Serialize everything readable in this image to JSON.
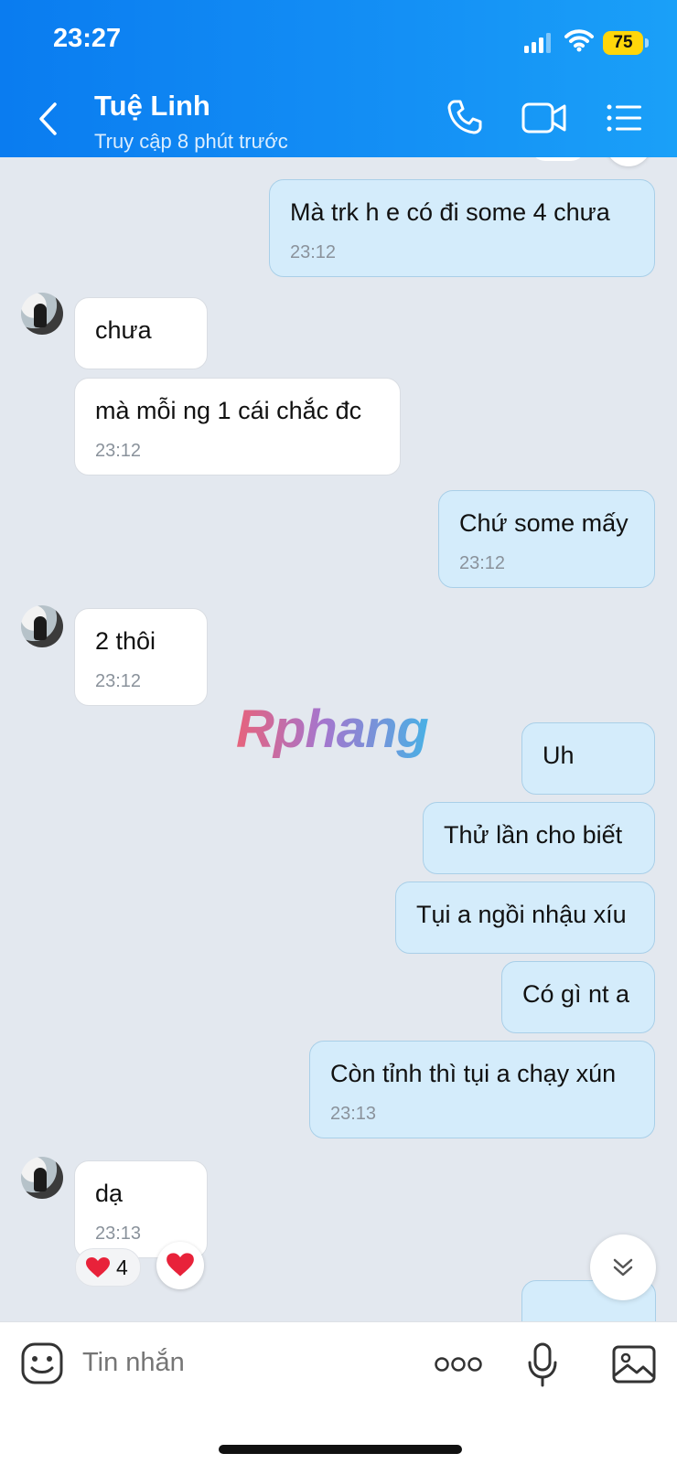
{
  "status_bar": {
    "time": "23:27",
    "battery": "75"
  },
  "header": {
    "contact_name": "Tuệ Linh",
    "contact_status": "Truy cập 8 phút trước"
  },
  "messages": [
    {
      "text": "Mà trk h e có đi some 4 chưa",
      "time": "23:12"
    },
    {
      "text": "chưa"
    },
    {
      "text": "mà mỗi ng 1 cái chắc đc",
      "time": "23:12"
    },
    {
      "text": "Chứ some mấy",
      "time": "23:12"
    },
    {
      "text": "2 thôi",
      "time": "23:12"
    },
    {
      "text": "Uh"
    },
    {
      "text": "Thử lần cho biết"
    },
    {
      "text": "Tụi a ngồi nhậu xíu"
    },
    {
      "text": "Có gì nt a"
    },
    {
      "text": "Còn tỉnh thì tụi a chạy xún",
      "time": "23:13"
    },
    {
      "text": "dạ",
      "time": "23:13"
    }
  ],
  "reaction": {
    "count": "4"
  },
  "watermark": "Rphang",
  "input": {
    "placeholder": "Tin nhắn"
  },
  "colors": {
    "header": "#0a7cf0",
    "outgoing_bubble": "#d4ecfb",
    "incoming_bubble": "#ffffff",
    "background": "#e3e8ef"
  }
}
